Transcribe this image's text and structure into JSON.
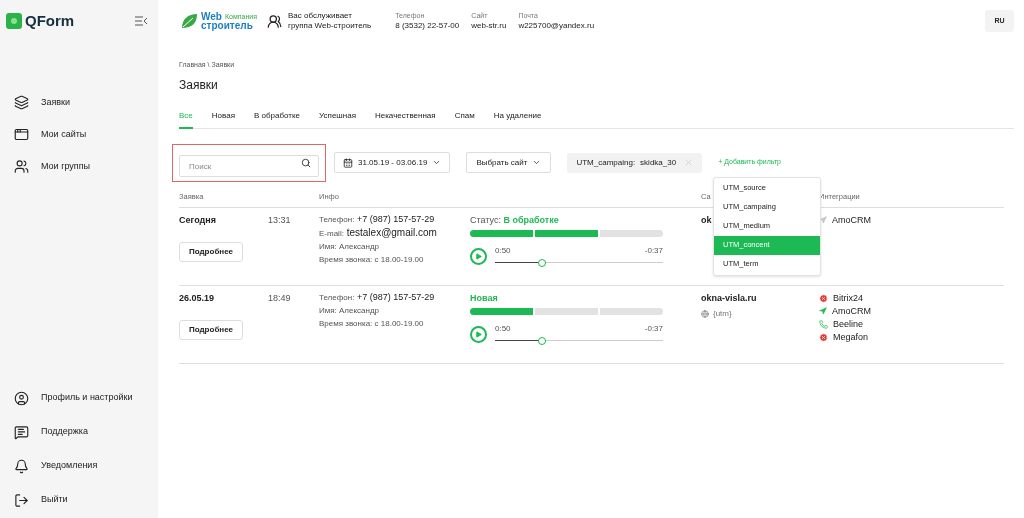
{
  "sidebar": {
    "logo": "QForm",
    "items": [
      {
        "label": "Заявки"
      },
      {
        "label": "Мои сайты"
      },
      {
        "label": "Мои группы"
      }
    ],
    "bottom_items": [
      {
        "label": "Профиль и настройки"
      },
      {
        "label": "Поддержка"
      },
      {
        "label": "Уведомления"
      },
      {
        "label": "Выйти"
      }
    ]
  },
  "header": {
    "brand": {
      "line1": "Web",
      "line2": "строитель",
      "tag": "Компания"
    },
    "service": [
      "Вас обслуживает",
      "группа Web-строитель"
    ],
    "contacts": [
      {
        "label": "Телефон",
        "value": "8 (3532) 22-57-00"
      },
      {
        "label": "Сайт",
        "value": "web-str.ru"
      },
      {
        "label": "Почта",
        "value": "w225700@yandex.ru"
      }
    ],
    "language": "RU"
  },
  "breadcrumb": "Главная \\ Заявки",
  "title": "Заявки",
  "tabs": [
    {
      "label": "Все",
      "selected": true
    },
    {
      "label": "Новая",
      "selected": false
    },
    {
      "label": "В обработке",
      "selected": false
    },
    {
      "label": "Успешная",
      "selected": false
    },
    {
      "label": "Некачественная",
      "selected": false
    },
    {
      "label": "Спам",
      "selected": false
    },
    {
      "label": "На удаление",
      "selected": false
    }
  ],
  "filters": {
    "search": {
      "placeholder": "Поиск"
    },
    "date_range": "31.05.19 - 03.06.19",
    "site_select": "Выбрать сайт",
    "chip": {
      "key": "UTM_campaing:",
      "value": "skidka_30"
    },
    "add_filter": "+ Добавить фильтр",
    "menu": [
      {
        "label": "UTM_source",
        "selected": false
      },
      {
        "label": "UTM_campaing",
        "selected": false
      },
      {
        "label": "UTM_medium",
        "selected": false
      },
      {
        "label": "UTM_concent",
        "selected": true
      },
      {
        "label": "UTM_term",
        "selected": false
      }
    ]
  },
  "table": {
    "columns": [
      "Заявка",
      "Инфо",
      "Са",
      "Интеграции"
    ],
    "rows": [
      {
        "date": "Сегодня",
        "time": "13:31",
        "details": "Подробнее",
        "info": [
          {
            "label": "Телефон:",
            "value": "+7 (987) 157-57-29"
          },
          {
            "label": "E-mail:",
            "value": "testalex@gmail.com"
          },
          {
            "label": "Имя: Александр"
          },
          {
            "label": "Время звонка: с 18.00-19.00"
          }
        ],
        "status_prefix": "Статус:",
        "status": "В обработке",
        "level": 0.667,
        "audio": {
          "elapsed": "0:50",
          "remaining": "-0:37",
          "level": 0.28
        },
        "site": "ok",
        "integrations": [
          {
            "kind": "crm",
            "name": "AmoCRM",
            "active": false
          }
        ]
      },
      {
        "date": "26.05.19",
        "time": "18:49",
        "details": "Подробнее",
        "info": [
          {
            "label": "Телефон:",
            "value": "+7 (987) 157-57-29"
          },
          {
            "label": "Имя: Александр"
          },
          {
            "label": "Время звонка: с 18.00-19.00"
          }
        ],
        "status": "Новая",
        "level": 0.333,
        "audio": {
          "elapsed": "0:50",
          "remaining": "-0:37",
          "level": 0.28
        },
        "site": "okna-visla.ru",
        "utm": "{utm}",
        "integrations": [
          {
            "kind": "error",
            "name": "Bitrix24",
            "active": true
          },
          {
            "kind": "crm",
            "name": "AmoCRM",
            "active": true
          },
          {
            "kind": "phone",
            "name": "Beeline",
            "active": true
          },
          {
            "kind": "error",
            "name": "Megafon",
            "active": true
          }
        ]
      }
    ]
  }
}
